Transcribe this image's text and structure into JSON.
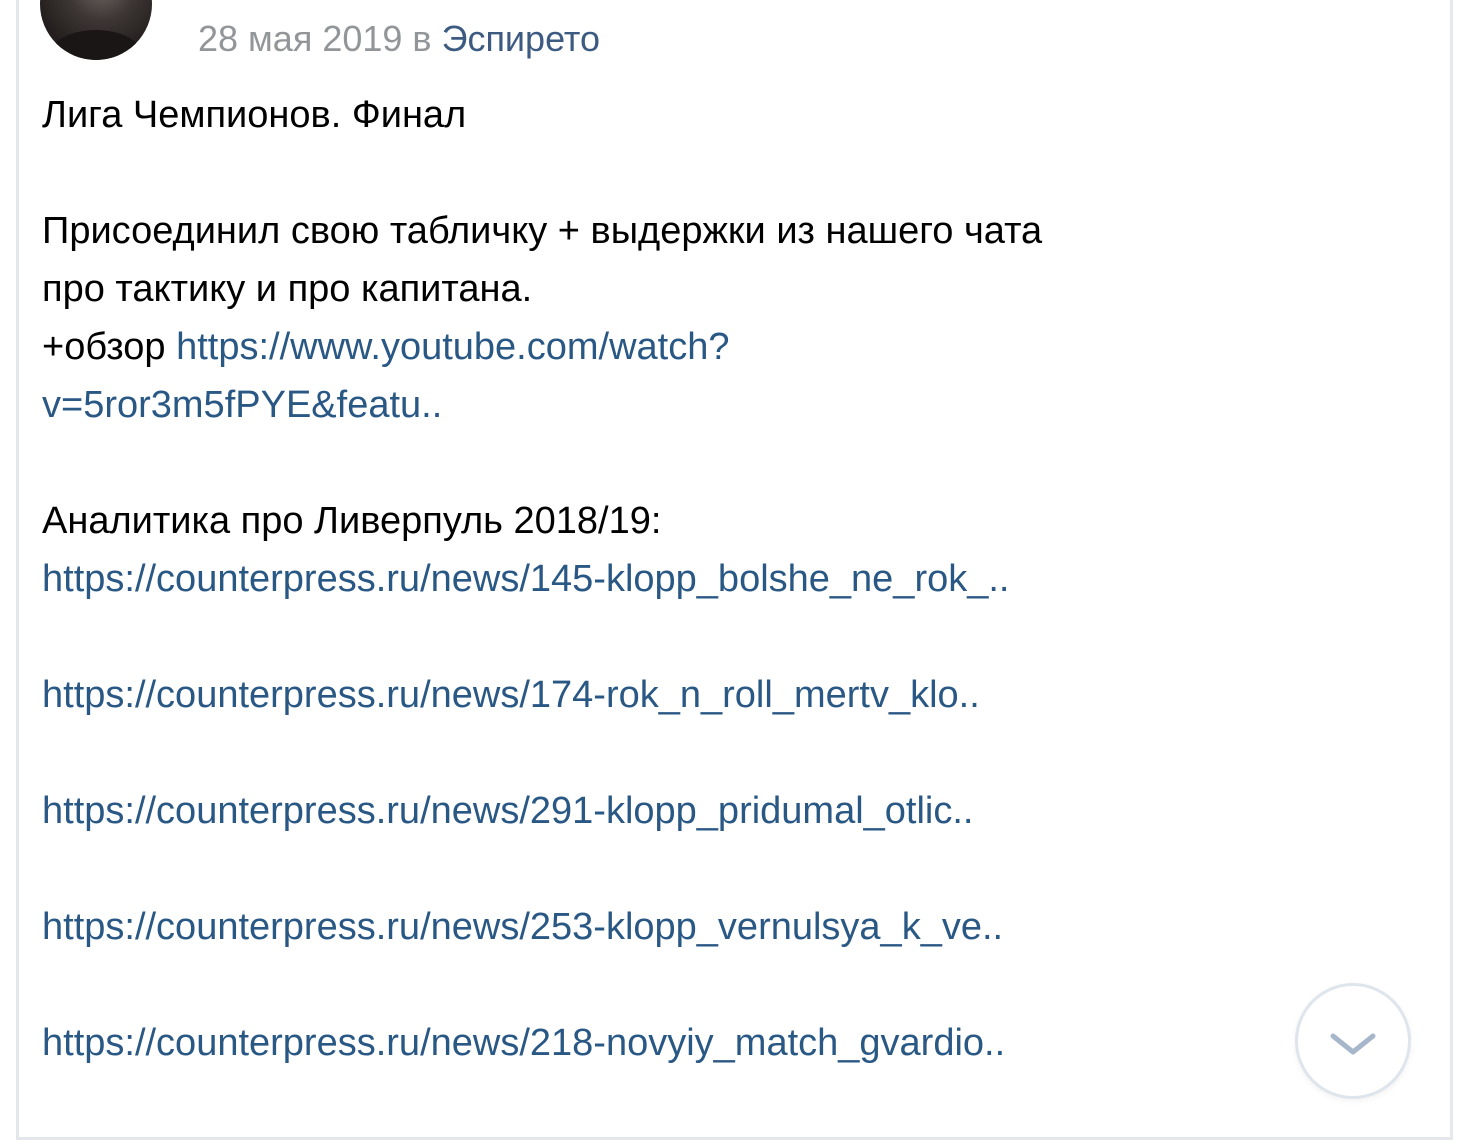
{
  "post": {
    "date": "28 мая 2019",
    "in_word": "в",
    "group": "Эспирето",
    "title": "Лига Чемпионов. Финал",
    "para1_line1": "Присоединил свою табличку + выдержки из нашего чата",
    "para1_line2": "про тактику и про капитана.",
    "review_prefix": "+обзор",
    "review_link_line1": "https://www.youtube.com/watch?",
    "review_link_line2": "v=5ror3m5fPYE&featu..",
    "analytics_heading": "Аналитика про Ливерпуль 2018/19:",
    "links": [
      "https://counterpress.ru/news/145-klopp_bolshe_ne_rok_..",
      "https://counterpress.ru/news/174-rok_n_roll_mertv_klo..",
      "https://counterpress.ru/news/291-klopp_pridumal_otlic..",
      "https://counterpress.ru/news/253-klopp_vernulsya_k_ve..",
      "https://counterpress.ru/news/218-novyiy_match_gvardio.."
    ]
  },
  "controls": {
    "scroll_down_icon": "chevron-down-icon"
  },
  "colors": {
    "link": "#2a5885",
    "meta": "#939699",
    "group_link": "#3d5a80",
    "text": "#000000"
  }
}
